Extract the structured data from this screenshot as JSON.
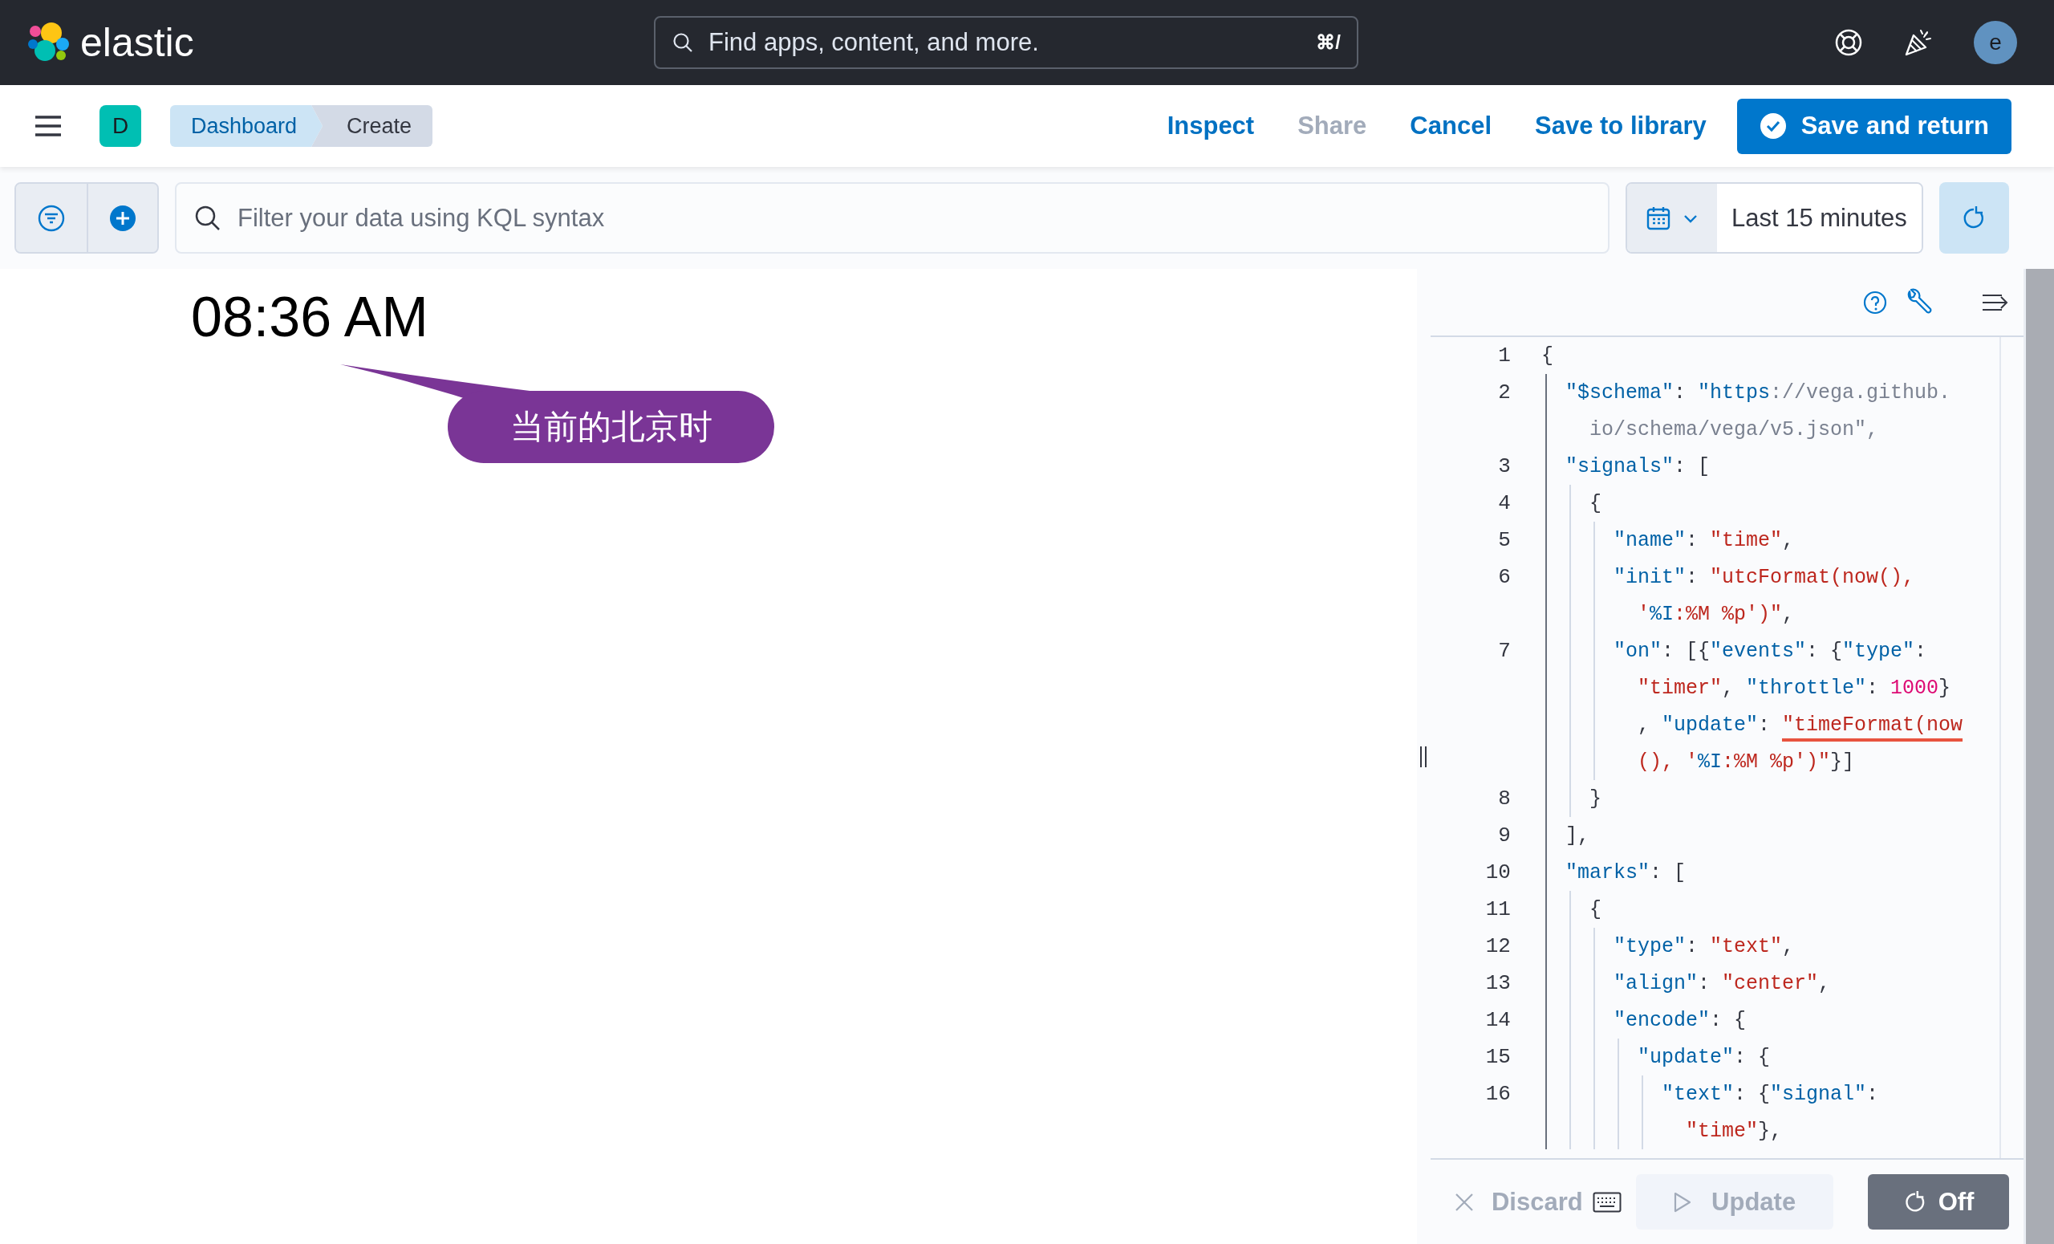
{
  "header": {
    "logo_text": "elastic",
    "search": {
      "placeholder": "Find apps, content, and more.",
      "shortcut": "⌘/"
    },
    "avatar": "e"
  },
  "app_bar": {
    "space_badge": "D",
    "breadcrumbs": [
      {
        "label": "Dashboard",
        "current": false
      },
      {
        "label": "Create",
        "current": true
      }
    ],
    "actions": [
      {
        "label": "Inspect",
        "kind": "link",
        "disabled": false
      },
      {
        "label": "Share",
        "kind": "link",
        "disabled": true
      },
      {
        "label": "Cancel",
        "kind": "link",
        "disabled": false
      },
      {
        "label": "Save to library",
        "kind": "link",
        "disabled": false
      },
      {
        "label": "Save and return",
        "kind": "primary",
        "disabled": false
      }
    ]
  },
  "query_bar": {
    "placeholder": "Filter your data using KQL syntax",
    "time_range": "Last 15 minutes"
  },
  "preview": {
    "clock_text": "08:36 AM"
  },
  "annotation": {
    "text": "当前的北京时"
  },
  "editor": {
    "lines": [
      {
        "number": "1",
        "tokens": [
          {
            "kind": "punct",
            "text": "{"
          }
        ]
      },
      {
        "number": "2",
        "tokens": [
          {
            "kind": "key",
            "text": "  \"$schema\""
          },
          {
            "kind": "punct",
            "text": ": "
          },
          {
            "kind": "key",
            "text": "\"https"
          },
          {
            "kind": "muted",
            "text": "://vega.github."
          }
        ]
      },
      {
        "tokens": [
          {
            "kind": "muted",
            "text": "    io/schema/vega/v5.json\","
          }
        ]
      },
      {
        "number": "3",
        "tokens": [
          {
            "kind": "key",
            "text": "  \"signals\""
          },
          {
            "kind": "punct",
            "text": ": ["
          }
        ]
      },
      {
        "number": "4",
        "tokens": [
          {
            "kind": "punct",
            "text": "    {"
          }
        ]
      },
      {
        "number": "5",
        "tokens": [
          {
            "kind": "key",
            "text": "      \"name\""
          },
          {
            "kind": "punct",
            "text": ": "
          },
          {
            "kind": "string",
            "text": "\"time\""
          },
          {
            "kind": "punct",
            "text": ","
          }
        ]
      },
      {
        "number": "6",
        "tokens": [
          {
            "kind": "key",
            "text": "      \"init\""
          },
          {
            "kind": "punct",
            "text": ": "
          },
          {
            "kind": "string",
            "text": "\"utcFormat(now(),"
          }
        ]
      },
      {
        "tokens": [
          {
            "kind": "string",
            "text": "        '"
          },
          {
            "kind": "key",
            "text": "%I"
          },
          {
            "kind": "string",
            "text": ":%M %p')\""
          },
          {
            "kind": "punct",
            "text": ","
          }
        ]
      },
      {
        "number": "7",
        "tokens": [
          {
            "kind": "key",
            "text": "      \"on\""
          },
          {
            "kind": "punct",
            "text": ": [{"
          },
          {
            "kind": "key",
            "text": "\"events\""
          },
          {
            "kind": "punct",
            "text": ": {"
          },
          {
            "kind": "key",
            "text": "\"type\""
          },
          {
            "kind": "punct",
            "text": ":"
          }
        ]
      },
      {
        "tokens": [
          {
            "kind": "string",
            "text": "        \"timer\""
          },
          {
            "kind": "punct",
            "text": ", "
          },
          {
            "kind": "key",
            "text": "\"throttle\""
          },
          {
            "kind": "punct",
            "text": ": "
          },
          {
            "kind": "number",
            "text": "1000"
          },
          {
            "kind": "punct",
            "text": "}"
          }
        ]
      },
      {
        "tokens": [
          {
            "kind": "punct",
            "text": "        , "
          },
          {
            "kind": "key",
            "text": "\"update\""
          },
          {
            "kind": "punct",
            "text": ": "
          },
          {
            "kind": "string",
            "text": "\"timeFormat(now",
            "underlined": true
          }
        ]
      },
      {
        "tokens": [
          {
            "kind": "string",
            "text": "        (), '"
          },
          {
            "kind": "key",
            "text": "%I"
          },
          {
            "kind": "string",
            "text": ":%M %p')\""
          },
          {
            "kind": "punct",
            "text": "}]"
          }
        ]
      },
      {
        "number": "8",
        "tokens": [
          {
            "kind": "punct",
            "text": "    }"
          }
        ]
      },
      {
        "number": "9",
        "tokens": [
          {
            "kind": "punct",
            "text": "  ],"
          }
        ]
      },
      {
        "number": "10",
        "tokens": [
          {
            "kind": "key",
            "text": "  \"marks\""
          },
          {
            "kind": "punct",
            "text": ": ["
          }
        ]
      },
      {
        "number": "11",
        "tokens": [
          {
            "kind": "punct",
            "text": "    {"
          }
        ]
      },
      {
        "number": "12",
        "tokens": [
          {
            "kind": "key",
            "text": "      \"type\""
          },
          {
            "kind": "punct",
            "text": ": "
          },
          {
            "kind": "string",
            "text": "\"text\""
          },
          {
            "kind": "punct",
            "text": ","
          }
        ]
      },
      {
        "number": "13",
        "tokens": [
          {
            "kind": "key",
            "text": "      \"align\""
          },
          {
            "kind": "punct",
            "text": ": "
          },
          {
            "kind": "string",
            "text": "\"center\""
          },
          {
            "kind": "punct",
            "text": ","
          }
        ]
      },
      {
        "number": "14",
        "tokens": [
          {
            "kind": "key",
            "text": "      \"encode\""
          },
          {
            "kind": "punct",
            "text": ": {"
          }
        ]
      },
      {
        "number": "15",
        "tokens": [
          {
            "kind": "key",
            "text": "        \"update\""
          },
          {
            "kind": "punct",
            "text": ": {"
          }
        ]
      },
      {
        "number": "16",
        "tokens": [
          {
            "kind": "key",
            "text": "          \"text\""
          },
          {
            "kind": "punct",
            "text": ": {"
          },
          {
            "kind": "key",
            "text": "\"signal\""
          },
          {
            "kind": "punct",
            "text": ":"
          }
        ]
      },
      {
        "tokens": [
          {
            "kind": "string",
            "text": "            \"time\""
          },
          {
            "kind": "punct",
            "text": "},"
          }
        ]
      }
    ],
    "footer": {
      "discard": {
        "label": "Discard",
        "disabled": true
      },
      "update": {
        "label": "Update",
        "disabled": true
      },
      "auto_refresh": {
        "label": "Off"
      }
    }
  }
}
